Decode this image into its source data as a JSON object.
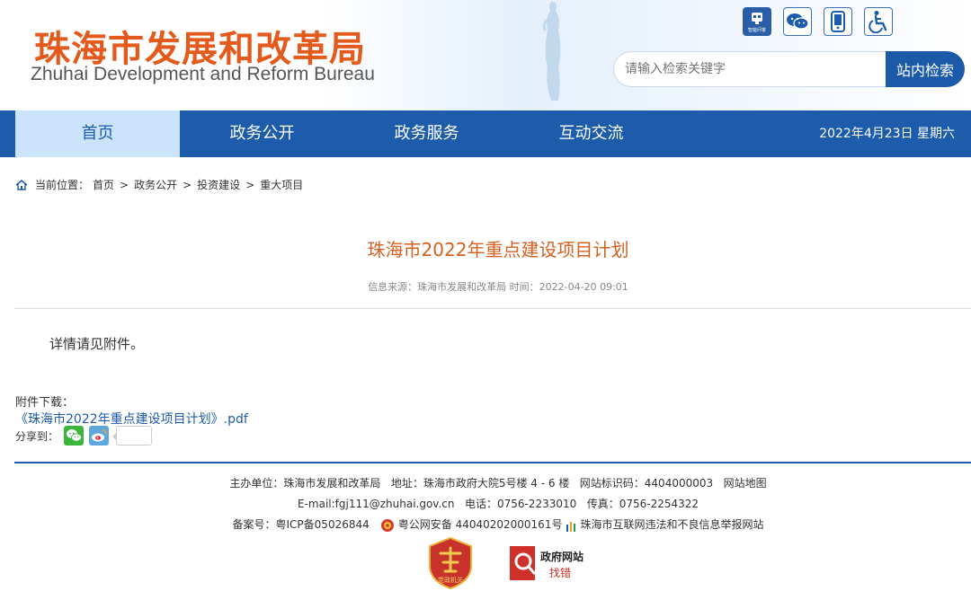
{
  "header": {
    "logo_cn": "珠海市发展和改革局",
    "logo_en": "Zhuhai Development and Reform Bureau",
    "icons": [
      "smart-qa-icon",
      "wechat-icon",
      "mobile-icon",
      "accessibility-icon"
    ],
    "smart_qa_label": "智能问答",
    "search_placeholder": "请输入检索关键字",
    "search_button": "站内检索"
  },
  "nav": {
    "items": [
      "首页",
      "政务公开",
      "政务服务",
      "互动交流"
    ],
    "active_index": 0,
    "date": "2022年4月23日 星期六"
  },
  "breadcrumb": {
    "prefix": "当前位置：",
    "items": [
      "首页",
      "政务公开",
      "投资建设",
      "重大项目"
    ]
  },
  "article": {
    "title": "珠海市2022年重点建设项目计划",
    "meta": "信息来源：珠海市发展和改革局 时间：2022-04-20 09:01",
    "body": "详情请见附件。",
    "attach_label": "附件下载：",
    "attach_link": "《珠海市2022年重点建设项目计划》.pdf",
    "share_label": "分享到："
  },
  "footer": {
    "line1": "主办单位：珠海市发展和改革局   地址：珠海市政府大院5号楼 4 - 6 楼   网站标识码：4404000003   网站地图",
    "line2": "E-mail:fgj111@zhuhai.gov.cn   电话：0756-2233010   传真：0756-2254322",
    "icp": "备案号：粤ICP备05026844",
    "police": "粤公网安备 44040202000161号",
    "report": "珠海市互联网违法和不良信息举报网站",
    "badge_party": "党政机关",
    "badge_gov_title": "政府网站",
    "badge_gov_sub": "找错"
  },
  "colors": {
    "brand_blue": "#1d5cab",
    "logo_orange": "#e35a1c",
    "title_orange": "#d5601f",
    "nav_active_bg": "#cbe3fb"
  }
}
